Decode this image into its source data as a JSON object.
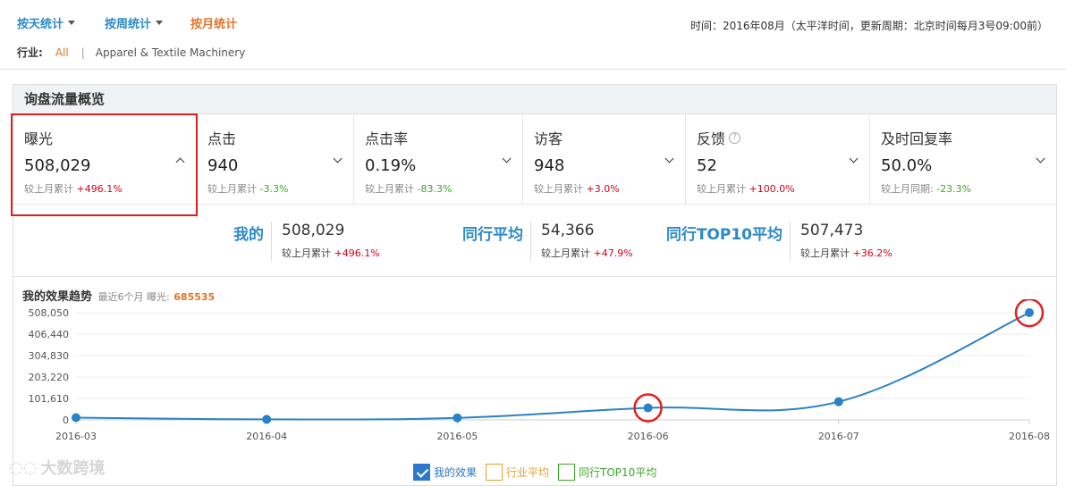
{
  "tabs": [
    {
      "label": "按天统计",
      "active": false
    },
    {
      "label": "按周统计",
      "active": false
    },
    {
      "label": "按月统计",
      "active": true
    }
  ],
  "time_info": "时间：2016年08月（太平洋时间，更新周期：北京时间每月3号09:00前）",
  "industry": {
    "label": "行业:",
    "all": "All",
    "separator": "|",
    "selected": "Apparel & Textile Machinery"
  },
  "panel_title": "询盘流量概览",
  "metrics": [
    {
      "name": "曝光",
      "value": "508,029",
      "cmp_label": "较上月累计",
      "change": "+496.1%",
      "dir": "up",
      "expanded": true
    },
    {
      "name": "点击",
      "value": "940",
      "cmp_label": "较上月累计",
      "change": "-3.3%",
      "dir": "down",
      "expanded": false
    },
    {
      "name": "点击率",
      "value": "0.19%",
      "cmp_label": "较上月累计",
      "change": "-83.3%",
      "dir": "down",
      "expanded": false
    },
    {
      "name": "访客",
      "value": "948",
      "cmp_label": "较上月累计",
      "change": "+3.0%",
      "dir": "up",
      "expanded": false
    },
    {
      "name": "反馈",
      "value": "52",
      "cmp_label": "较上月累计",
      "change": "+100.0%",
      "dir": "up",
      "expanded": false,
      "help_icon": "?"
    },
    {
      "name": "及时回复率",
      "value": "50.0%",
      "cmp_label": "较上月同期:",
      "change": "-23.3%",
      "dir": "down",
      "expanded": false
    }
  ],
  "comparison": [
    {
      "label": "我的",
      "value": "508,029",
      "cmp_label": "较上月累计",
      "change": "+496.1%"
    },
    {
      "label": "同行平均",
      "value": "54,366",
      "cmp_label": "较上月累计",
      "change": "+47.9%"
    },
    {
      "label": "同行TOP10平均",
      "value": "507,473",
      "cmp_label": "较上月累计",
      "change": "+36.2%"
    }
  ],
  "trend": {
    "title": "我的效果趋势",
    "subtitle": "最近6个月 曝光:",
    "total": "685535"
  },
  "chart_data": {
    "type": "line",
    "x": [
      "2016-03",
      "2016-04",
      "2016-05",
      "2016-06",
      "2016-07",
      "2016-08"
    ],
    "ytick_labels": [
      "508,050",
      "406,440",
      "304,830",
      "203,220",
      "101,610",
      "0"
    ],
    "ylim": [
      0,
      508050
    ],
    "series": [
      {
        "name": "我的效果",
        "values": [
          10500,
          2500,
          9500,
          57000,
          86000,
          508029
        ],
        "color": "#2a82c6"
      }
    ],
    "highlighted_points": [
      "2016-06",
      "2016-08"
    ],
    "grid": true
  },
  "legend": [
    {
      "label": "我的效果",
      "checked": true,
      "color": "#2d78c8"
    },
    {
      "label": "行业平均",
      "checked": false,
      "color": "#e0a030"
    },
    {
      "label": "同行TOP10平均",
      "checked": false,
      "color": "#3ea52a"
    }
  ],
  "watermark": "大数跨境"
}
